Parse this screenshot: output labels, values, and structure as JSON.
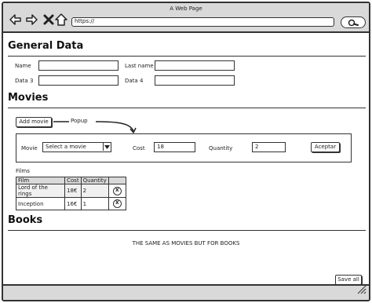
{
  "window": {
    "title": "A Web Page"
  },
  "browser": {
    "url": "https://"
  },
  "general": {
    "title": "General Data",
    "fields": {
      "name": {
        "label": "Name",
        "value": ""
      },
      "last_name": {
        "label": "Last name",
        "value": ""
      },
      "data3": {
        "label": "Data 3",
        "value": ""
      },
      "data4": {
        "label": "Data 4",
        "value": ""
      }
    }
  },
  "movies": {
    "title": "Movies",
    "add_button": "Add movie",
    "popup_callout": "Popup",
    "popup": {
      "movie_label": "Movie",
      "movie_select": "Select a movie",
      "cost_label": "Cost",
      "cost_value": "18",
      "quantity_label": "Quantity",
      "quantity_value": "2",
      "accept_button": "Aceptar"
    },
    "films_label": "Films",
    "table": {
      "headers": [
        "Film",
        "Cost",
        "Quantity"
      ],
      "rows": [
        [
          "Lord of the rings",
          "18€",
          "2"
        ],
        [
          "Inception",
          "16€",
          "1"
        ]
      ],
      "remove_label": "X"
    }
  },
  "books": {
    "title": "Books",
    "note": "THE SAME AS MOVIES BUT FOR BOOKS"
  },
  "save_all": "Save all",
  "icons": [
    "back-arrow-icon",
    "forward-arrow-icon",
    "close-icon",
    "home-icon",
    "search-icon",
    "resize-grip-icon"
  ]
}
